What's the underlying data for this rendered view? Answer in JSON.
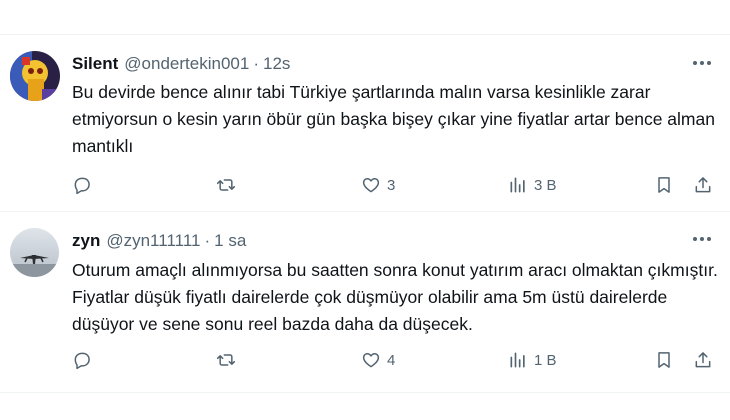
{
  "tweets": [
    {
      "name": "Silent",
      "handle": "@ondertekin001",
      "separator": "·",
      "time": "12s",
      "text": "Bu devirde bence alınır tabi Türkiye şartlarında malın varsa kesinlikle zarar etmiyorsun o kesin yarın öbür gün başka bişey çıkar yine fiyatlar artar bence alman mantıklı",
      "likes": "3",
      "views": "3 B"
    },
    {
      "name": "zyn",
      "handle": "@zyn111111",
      "separator": "·",
      "time": "1 sa",
      "text": "Oturum amaçlı alınmıyorsa bu saatten sonra konut yatırım aracı olmaktan çıkmıştır. Fiyatlar düşük fiyatlı dairelerde çok düşmüyor olabilir ama 5m üstü dairelerde düşüyor ve sene sonu reel bazda daha da düşecek.",
      "likes": "4",
      "views": "1 B"
    }
  ],
  "icons": [
    "reply-icon",
    "retweet-icon",
    "like-icon",
    "views-icon",
    "bookmark-icon",
    "share-icon",
    "more-icon"
  ],
  "colors": {
    "text": "#0f1419",
    "secondary": "#536471",
    "divider": "#eff3f4"
  }
}
